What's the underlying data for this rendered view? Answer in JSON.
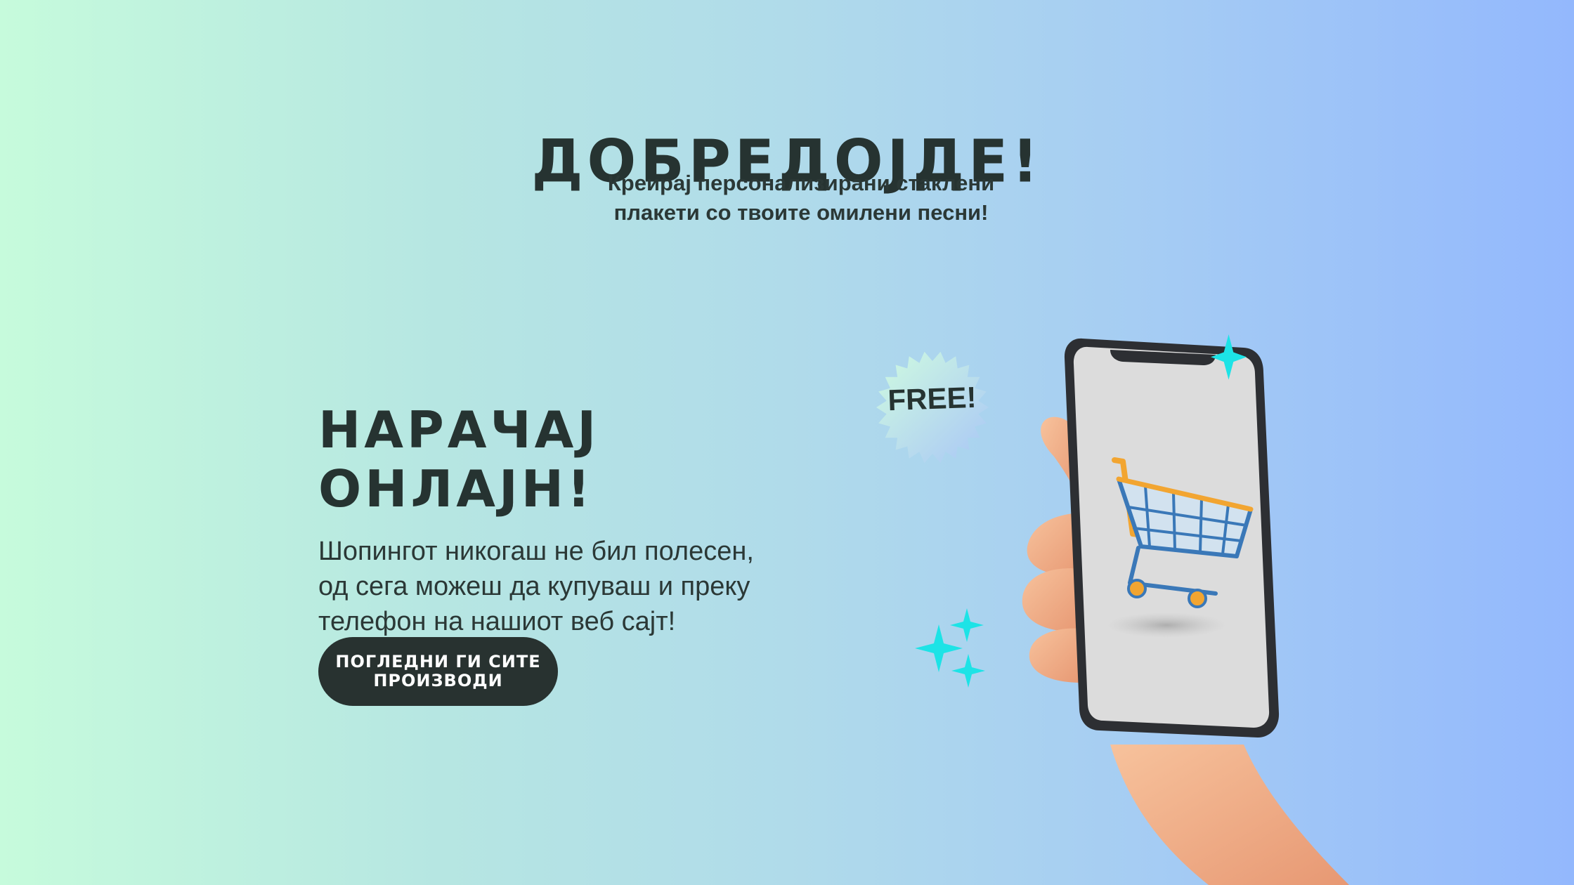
{
  "hero": {
    "title": "ДОБРЕДОЈДЕ!",
    "tagline_line1": "Креирај персонализирани стаклени",
    "tagline_line2": "плакети со твоите омилени песни!"
  },
  "promo": {
    "title_line1": "НАРАЧАЈ",
    "title_line2": "ОНЛАЈН!",
    "desc_line1": "Шопингот никогаш не бил полесен,",
    "desc_line2": "од сега можеш да купуваш и преку",
    "desc_line3": "телефон на нашиот веб сајт!",
    "cta_line1": "ПОГЛЕДНИ ГИ СИТЕ",
    "cta_line2": "ПРОИЗВОДИ"
  },
  "illustration": {
    "badge": "FREE!",
    "icons": [
      "hand-icon",
      "phone-icon",
      "shopping-cart-icon",
      "sparkle-icon"
    ]
  },
  "colors": {
    "text": "#263331",
    "button": "#283230",
    "sparkle": "#1de3e6",
    "cart_frame": "#3a78b8",
    "cart_handle": "#f2a531"
  }
}
